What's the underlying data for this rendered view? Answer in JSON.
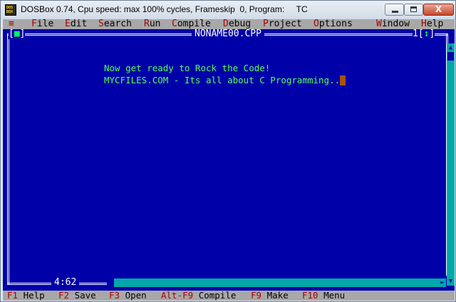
{
  "window": {
    "title": "DOSBox 0.74, Cpu speed: max 100% cycles, Frameskip  0, Program:     TC",
    "icon_text": "DOS BOX",
    "minimize_icon": "minimize-icon",
    "maximize_icon": "maximize-icon",
    "close_label": "X"
  },
  "menu": {
    "system": "≡",
    "items": [
      {
        "hot": "F",
        "rest": "ile"
      },
      {
        "hot": "E",
        "rest": "dit"
      },
      {
        "hot": "S",
        "rest": "earch"
      },
      {
        "hot": "R",
        "rest": "un"
      },
      {
        "hot": "C",
        "rest": "ompile"
      },
      {
        "hot": "D",
        "rest": "ebug"
      },
      {
        "hot": "P",
        "rest": "roject"
      },
      {
        "hot": "O",
        "rest": "ptions"
      },
      {
        "hot": "W",
        "rest": "indow"
      },
      {
        "hot": "H",
        "rest": "elp"
      }
    ]
  },
  "editor": {
    "file_name": "NONAME00.CPP",
    "close_box_open": "[",
    "close_box_mark": "■",
    "close_box_close": "]",
    "window_number": "1",
    "zoom_box_open": "[",
    "zoom_box_mark": "↕",
    "zoom_box_close": "]",
    "lines": [
      "Now get ready to Rock the Code!",
      "MYCFILES.COM - Its all about C Programming.."
    ],
    "cursor_position": "4:62",
    "cursor_color": "#a85400",
    "text_color": "#55ff55",
    "background_color": "#0000a8"
  },
  "status": {
    "keys": [
      {
        "key": "F1",
        "label": "Help"
      },
      {
        "key": "F2",
        "label": "Save"
      },
      {
        "key": "F3",
        "label": "Open"
      },
      {
        "key": "Alt-F9",
        "label": "Compile"
      },
      {
        "key": "F9",
        "label": "Make"
      },
      {
        "key": "F10",
        "label": "Menu"
      }
    ]
  }
}
